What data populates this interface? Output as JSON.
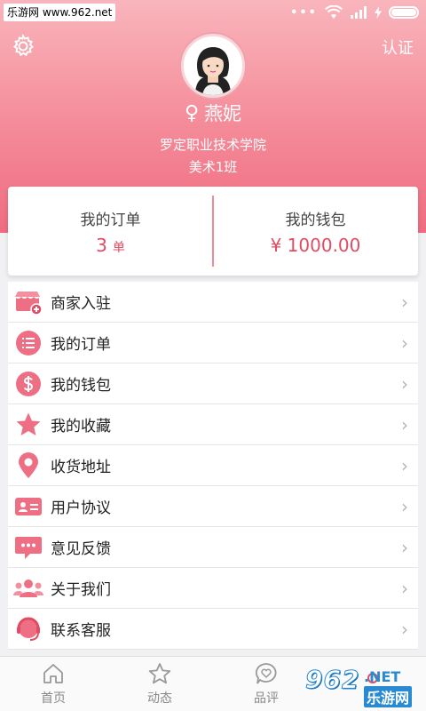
{
  "status_bar": {
    "watermark": "乐游网 www.962.net",
    "signal_dots": "•••"
  },
  "header": {
    "verify_label": "认证",
    "gender_symbol": "♀",
    "user_name": "燕妮",
    "school": "罗定职业技术学院",
    "class_name": "美术1班"
  },
  "summary": {
    "orders_label": "我的订单",
    "orders_count": "3",
    "orders_unit": "单",
    "wallet_label": "我的钱包",
    "wallet_amount": "¥ 1000.00"
  },
  "menu": [
    {
      "label": "商家入驻",
      "icon": "store-icon"
    },
    {
      "label": "我的订单",
      "icon": "list-icon"
    },
    {
      "label": "我的钱包",
      "icon": "dollar-icon"
    },
    {
      "label": "我的收藏",
      "icon": "star-icon"
    },
    {
      "label": "收货地址",
      "icon": "location-pin-icon"
    },
    {
      "label": "用户协议",
      "icon": "id-card-icon"
    },
    {
      "label": "意见反馈",
      "icon": "chat-bubble-icon"
    },
    {
      "label": "关于我们",
      "icon": "group-icon"
    },
    {
      "label": "联系客服",
      "icon": "headset-icon"
    }
  ],
  "chevron": "›",
  "tabs": [
    {
      "label": "首页",
      "icon": "home-icon"
    },
    {
      "label": "动态",
      "icon": "star-outline-icon"
    },
    {
      "label": "品评",
      "icon": "heart-chat-icon"
    },
    {
      "label": "",
      "icon": "profile-icon"
    }
  ],
  "watermark_bottom": {
    "logo": "962",
    "dotnet": ".NET",
    "cn": "乐游网"
  },
  "colors": {
    "accent": "#e14b63",
    "header_top": "#f9b5bc",
    "header_bottom": "#ef6c80"
  }
}
